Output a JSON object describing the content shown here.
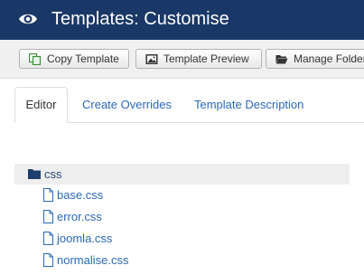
{
  "header": {
    "title": "Templates: Customise",
    "icon": "eye-icon",
    "background": "#1a3867"
  },
  "toolbar": {
    "copy_label": "Copy Template",
    "preview_label": "Template Preview",
    "folders_label": "Manage Folders"
  },
  "tabs": [
    {
      "label": "Editor",
      "active": true
    },
    {
      "label": "Create Overrides",
      "active": false
    },
    {
      "label": "Template Description",
      "active": false
    }
  ],
  "tree": {
    "folder": "css",
    "files": [
      "base.css",
      "error.css",
      "joomla.css",
      "normalise.css"
    ]
  },
  "colors": {
    "link": "#2a69b8",
    "folder_row_bg": "#eeeeee"
  }
}
